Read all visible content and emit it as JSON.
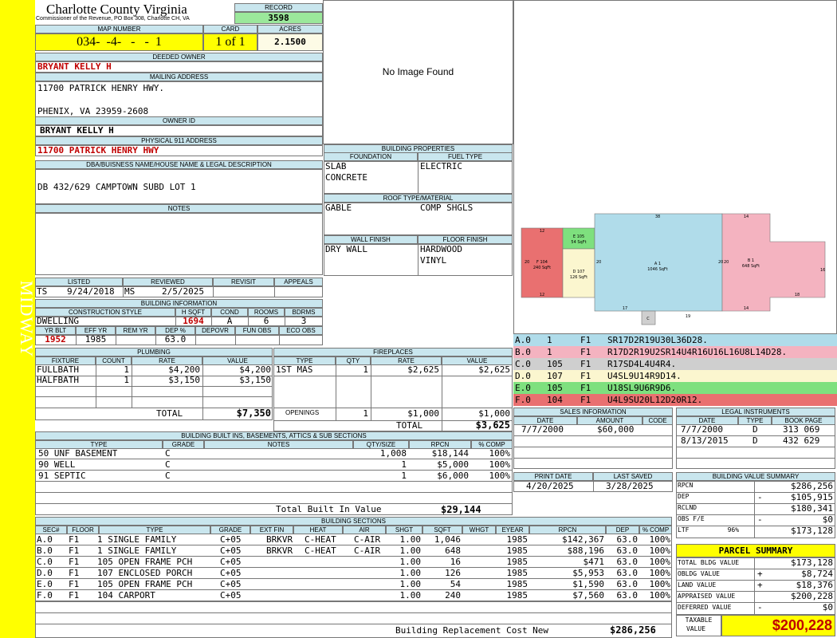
{
  "side_label": "MIDWAY",
  "county": {
    "title": "Charlotte County Virginia",
    "subtitle": "Commissioner of the Revenue, PO Box 308, Charlotte CH, VA"
  },
  "record": {
    "label": "RECORD",
    "value": "3598"
  },
  "map": {
    "label": "MAP NUMBER",
    "value": "034-  -4-   -   -  1"
  },
  "card": {
    "label": "CARD",
    "value": "1 of 1"
  },
  "acres": {
    "label": "ACRES",
    "value": "2.1500"
  },
  "deeded": {
    "label": "DEEDED OWNER",
    "value": "BRYANT KELLY H"
  },
  "mailing": {
    "label": "MAILING ADDRESS",
    "line1": "11700 PATRICK HENRY HWY.",
    "line2": "PHENIX, VA 23959-2608"
  },
  "owner_id": {
    "label": "OWNER ID",
    "value": "BRYANT KELLY H"
  },
  "physical": {
    "label": "PHYSICAL 911 ADDRESS",
    "value": "11700 PATRICK HENRY HWY"
  },
  "legal": {
    "label": "DBA/BUISNESS NAME/HOUSE NAME & LEGAL DESCRIPTION",
    "value": "DB 432/629 CAMPTOWN SUBD LOT 1"
  },
  "notes": {
    "label": "NOTES"
  },
  "no_image": "No Image Found",
  "listed": {
    "listed_label": "LISTED",
    "reviewed_label": "REVIEWED",
    "revisit_label": "REVISIT",
    "appeals_label": "APPEALS",
    "listed_by": "TS",
    "listed_date": "9/24/2018",
    "reviewed_by": "MS",
    "reviewed_date": "2/5/2025"
  },
  "bldg_info": {
    "label": "BUILDING INFORMATION",
    "h_style": "CONSTRUCTION STYLE",
    "h_hsqft": "H SQFT",
    "h_cond": "COND",
    "h_rooms": "ROOMS",
    "h_bdrms": "BDRMS",
    "style": "DWELLING",
    "hsqft": "1694",
    "cond": "A",
    "rooms": "6",
    "bdrms": "3",
    "h_yrblt": "YR BLT",
    "h_effyr": "EFF YR",
    "h_remyr": "REM YR",
    "h_dep": "DEP %",
    "h_depovr": "DEPOVR",
    "h_funobs": "FUN OBS",
    "h_ecoobs": "ECO OBS",
    "yrblt": "1952",
    "effyr": "1985",
    "dep": "63.0"
  },
  "props": {
    "label": "BUILDING PROPERTIES",
    "foundation_label": "FOUNDATION",
    "fuel_label": "FUEL TYPE",
    "foundation1": "SLAB",
    "foundation2": "CONCRETE",
    "fuel": "ELECTRIC",
    "roof_label": "ROOF TYPE/MATERIAL",
    "roof1": "GABLE",
    "roof2": "COMP SHGLS",
    "wall_label": "WALL FINISH",
    "floor_label": "FLOOR FINISH",
    "wall": "DRY WALL",
    "floor1": "HARDWOOD",
    "floor2": "VINYL"
  },
  "plumbing": {
    "label": "PLUMBING",
    "headers": [
      "FIXTURE",
      "COUNT",
      "RATE",
      "VALUE"
    ],
    "rows": [
      [
        "FULLBATH",
        "1",
        "$4,200",
        "$4,200"
      ],
      [
        "HALFBATH",
        "1",
        "$3,150",
        "$3,150"
      ]
    ],
    "total_label": "TOTAL",
    "total": "$7,350"
  },
  "fireplaces": {
    "label": "FIREPLACES",
    "headers": [
      "TYPE",
      "QTY",
      "RATE",
      "VALUE"
    ],
    "rows": [
      [
        "1ST MAS",
        "1",
        "$2,625",
        "$2,625"
      ]
    ],
    "openings_label": "OPENINGS",
    "openings": [
      "1",
      "$1,000",
      "$1,000"
    ],
    "total_label": "TOTAL",
    "total": "$3,625"
  },
  "builtins": {
    "label": "BUILDING BUILT INS, BASEMENTS, ATTICS & SUB SECTIONS",
    "headers": [
      "TYPE",
      "GRADE",
      "NOTES",
      "QTY/SIZE",
      "RPCN",
      "% COMP"
    ],
    "rows": [
      [
        "50 UNF BASEMENT",
        "C",
        "",
        "1,008",
        "$18,144",
        "100%"
      ],
      [
        "90 WELL",
        "C",
        "",
        "1",
        "$5,000",
        "100%"
      ],
      [
        "91 SEPTIC",
        "C",
        "",
        "1",
        "$6,000",
        "100%"
      ]
    ],
    "total_label": "Total Built In Value",
    "total": "$29,144"
  },
  "sections": {
    "label": "BUILDING SECTIONS",
    "headers": [
      "SEC#",
      "FLOOR",
      "TYPE",
      "GRADE",
      "EXT FIN",
      "HEAT",
      "AIR",
      "SHGT",
      "SQFT",
      "WHGT",
      "EYEAR",
      "RPCN",
      "DEP",
      "% COMP"
    ],
    "rows": [
      [
        "A.0",
        "F1",
        "1 SINGLE FAMILY",
        "C+05",
        "BRKVR",
        "C-HEAT",
        "C-AIR",
        "1.00",
        "1,046",
        "",
        "1985",
        "$142,367",
        "63.0",
        "100%"
      ],
      [
        "B.0",
        "F1",
        "1 SINGLE FAMILY",
        "C+05",
        "BRKVR",
        "C-HEAT",
        "C-AIR",
        "1.00",
        "648",
        "",
        "1985",
        "$88,196",
        "63.0",
        "100%"
      ],
      [
        "C.0",
        "F1",
        "105 OPEN FRAME PCH",
        "C+05",
        "",
        "",
        "",
        "1.00",
        "16",
        "",
        "1985",
        "$471",
        "63.0",
        "100%"
      ],
      [
        "D.0",
        "F1",
        "107 ENCLOSED PORCH",
        "C+05",
        "",
        "",
        "",
        "1.00",
        "126",
        "",
        "1985",
        "$5,953",
        "63.0",
        "100%"
      ],
      [
        "E.0",
        "F1",
        "105 OPEN FRAME PCH",
        "C+05",
        "",
        "",
        "",
        "1.00",
        "54",
        "",
        "1985",
        "$1,590",
        "63.0",
        "100%"
      ],
      [
        "F.0",
        "F1",
        "104 CARPORT",
        "C+05",
        "",
        "",
        "",
        "1.00",
        "240",
        "",
        "1985",
        "$7,560",
        "63.0",
        "100%"
      ]
    ],
    "total_label": "Building Replacement Cost New",
    "total": "$286,256"
  },
  "sketch": {
    "labels": {
      "a": "A 1",
      "a_area": "1046 SqFt",
      "b": "B 1",
      "b_area": "648 SqFt",
      "c": "C",
      "d": "D 107",
      "d_area": "126 SqFt",
      "e": "E 105",
      "e_area": "54 SqFt",
      "f": "F 104",
      "f_area": "240 SqFt"
    },
    "dims": [
      "12",
      "38",
      "14",
      "20",
      "20",
      "16",
      "18",
      "14",
      "17",
      "19",
      "12",
      "20",
      "20",
      "2",
      "4",
      "9",
      "6",
      "4",
      "9"
    ]
  },
  "vectors": [
    {
      "sec": "A.0",
      "code": "1",
      "floor": "F1",
      "vec": "SR17D2R19U30L36D28.",
      "color": "#b0dcea"
    },
    {
      "sec": "B.0",
      "code": "1",
      "floor": "F1",
      "vec": "R17D2R19U2SR14U4R16U16L16U8L14D28.",
      "color": "#f4b3c0"
    },
    {
      "sec": "C.0",
      "code": "105",
      "floor": "F1",
      "vec": "R17SD4L4U4R4.",
      "color": "#cfcfcf"
    },
    {
      "sec": "D.0",
      "code": "107",
      "floor": "F1",
      "vec": "U4SL9U14R9D14.",
      "color": "#fbf6cf"
    },
    {
      "sec": "E.0",
      "code": "105",
      "floor": "F1",
      "vec": "U18SL9U6R9D6.",
      "color": "#7ee07e"
    },
    {
      "sec": "F.0",
      "code": "104",
      "floor": "F1",
      "vec": "U4L9SU20L12D20R12.",
      "color": "#e97070"
    }
  ],
  "sales": {
    "label": "SALES INFORMATION",
    "headers": [
      "DATE",
      "AMOUNT",
      "CODE"
    ],
    "rows": [
      [
        "7/7/2000",
        "$60,000",
        ""
      ]
    ]
  },
  "legal_inst": {
    "label": "LEGAL INSTRUMENTS",
    "headers": [
      "DATE",
      "TYPE",
      "BOOK PAGE"
    ],
    "rows": [
      [
        "7/7/2000",
        "D",
        "313 069"
      ],
      [
        "8/13/2015",
        "D",
        "432 629"
      ]
    ]
  },
  "print": {
    "print_label": "PRINT DATE",
    "saved_label": "LAST SAVED",
    "print_date": "4/20/2025",
    "saved_date": "3/28/2025"
  },
  "value_summary": {
    "label": "BUILDING VALUE SUMMARY",
    "rows": [
      [
        "RPCN",
        "",
        "$286,256"
      ],
      [
        "DEP",
        "-",
        "$105,915"
      ],
      [
        "RCLND",
        "",
        "$180,341"
      ],
      [
        "OBS F/E",
        "-",
        "$0"
      ],
      [
        "LTF          96%",
        "",
        "$173,128"
      ]
    ]
  },
  "parcel": {
    "label": "PARCEL SUMMARY",
    "rows": [
      [
        "TOTAL BLDG VALUE",
        "",
        "$173,128"
      ],
      [
        "OBLDG VALUE",
        "+",
        "$8,724"
      ],
      [
        "LAND VALUE",
        "+",
        "$18,376"
      ],
      [
        "APPRAISED VALUE",
        "",
        "$200,228"
      ],
      [
        "DEFERRED VALUE",
        "-",
        "$0"
      ]
    ],
    "taxable_label1": "TAXABLE",
    "taxable_label2": "VALUE",
    "taxable": "$200,228"
  }
}
